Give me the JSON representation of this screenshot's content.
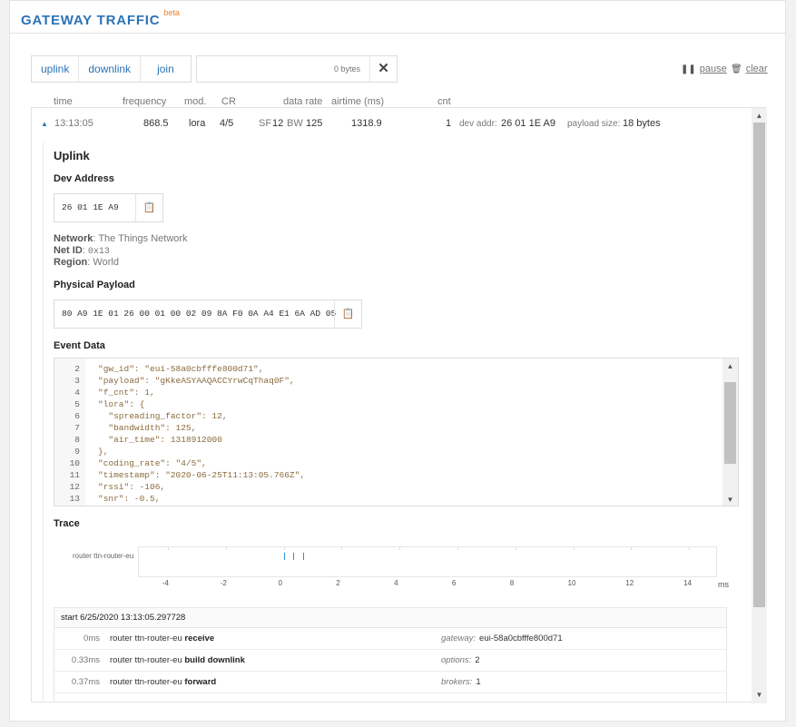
{
  "header": {
    "title": "GATEWAY TRAFFIC",
    "badge": "beta"
  },
  "filters": {
    "uplink": "uplink",
    "downlink": "downlink",
    "join": "join"
  },
  "search": {
    "value": "",
    "placeholder": "0 bytes"
  },
  "controls": {
    "pause": "pause",
    "clear": "clear"
  },
  "columns": {
    "time": "time",
    "frequency": "frequency",
    "mod": "mod.",
    "cr": "CR",
    "data_rate": "data rate",
    "airtime": "airtime (ms)",
    "cnt": "cnt"
  },
  "row": {
    "time": "13:13:05",
    "frequency": "868.5",
    "mod": "lora",
    "cr": "4/5",
    "sf_label": "SF",
    "sf": "12",
    "bw_label": "BW",
    "bw": "125",
    "airtime": "1318.9",
    "cnt": "1",
    "dev_addr_label": "dev addr:",
    "dev_addr": "26 01 1E A9",
    "payload_size_label": "payload size:",
    "payload_size": "18 bytes"
  },
  "detail": {
    "title": "Uplink",
    "dev_address_heading": "Dev Address",
    "dev_address": "26 01 1E A9",
    "network_label": "Network",
    "network": "The Things Network",
    "net_id_label": "Net ID",
    "net_id": "0x13",
    "region_label": "Region",
    "region": "World",
    "physical_payload_heading": "Physical Payload",
    "physical_payload": "80 A9 1E 01 26 00 01 00 02 09 8A F0 0A A4 E1 6A AD 05",
    "event_data_heading": "Event Data",
    "event_lines": [
      {
        "n": "2",
        "code": "\"gw_id\": \"eui-58a0cbfffe800d71\","
      },
      {
        "n": "3",
        "code": "\"payload\": \"gKkeASYAAQACCYrwCqThaq0F\","
      },
      {
        "n": "4",
        "code": "\"f_cnt\": 1,"
      },
      {
        "n": "5",
        "code": "\"lora\": {"
      },
      {
        "n": "6",
        "code": "  \"spreading_factor\": 12,"
      },
      {
        "n": "7",
        "code": "  \"bandwidth\": 125,"
      },
      {
        "n": "8",
        "code": "  \"air_time\": 1318912000"
      },
      {
        "n": "9",
        "code": "},"
      },
      {
        "n": "10",
        "code": "\"coding_rate\": \"4/5\","
      },
      {
        "n": "11",
        "code": "\"timestamp\": \"2020-06-25T11:13:05.766Z\","
      },
      {
        "n": "12",
        "code": "\"rssi\": -106,"
      },
      {
        "n": "13",
        "code": "\"snr\": -0.5,"
      }
    ],
    "trace_heading": "Trace",
    "trace_label": "router ttn-router-eu",
    "trace_ticks": [
      "-4",
      "-2",
      "0",
      "2",
      "4",
      "6",
      "8",
      "10",
      "12",
      "14"
    ],
    "trace_unit": "ms",
    "trace_events_ms": [
      0,
      0.33,
      0.37
    ],
    "log_start": "start 6/25/2020 13:13:05.297728",
    "log_rows": [
      {
        "t": "0ms",
        "src": "router ttn-router-eu",
        "action": "receive",
        "key": "gateway:",
        "val": "eui-58a0cbfffe800d71"
      },
      {
        "t": "0.33ms",
        "src": "router ttn-router-eu",
        "action": "build downlink",
        "key": "options:",
        "val": "2"
      },
      {
        "t": "0.37ms",
        "src": "router ttn-router-eu",
        "action": "forward",
        "key": "brokers:",
        "val": "1"
      }
    ]
  },
  "colors": {
    "accent": "#2b73b6",
    "badge": "#e7812f",
    "trace_mark": "#2b8fd6"
  }
}
